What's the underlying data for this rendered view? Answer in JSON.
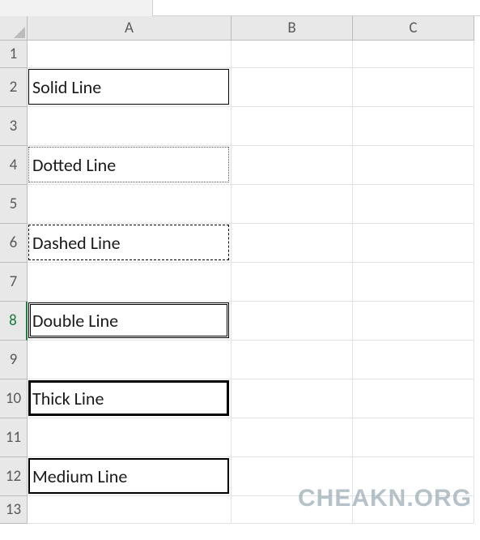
{
  "columns": {
    "A": "A",
    "B": "B",
    "C": "C"
  },
  "rows": {
    "1": "1",
    "2": "2",
    "3": "3",
    "4": "4",
    "5": "5",
    "6": "6",
    "7": "7",
    "8": "8",
    "9": "9",
    "10": "10",
    "11": "11",
    "12": "12",
    "13": "13"
  },
  "selected_row": 8,
  "cells": {
    "A2": {
      "value": "Solid Line",
      "border": "solid"
    },
    "A4": {
      "value": "Dotted Line",
      "border": "dotted"
    },
    "A6": {
      "value": "Dashed Line",
      "border": "dashed"
    },
    "A8": {
      "value": "Double Line",
      "border": "double"
    },
    "A10": {
      "value": "Thick Line",
      "border": "thick"
    },
    "A12": {
      "value": "Medium Line",
      "border": "medium"
    }
  },
  "watermark": "CHEAKN.ORG"
}
